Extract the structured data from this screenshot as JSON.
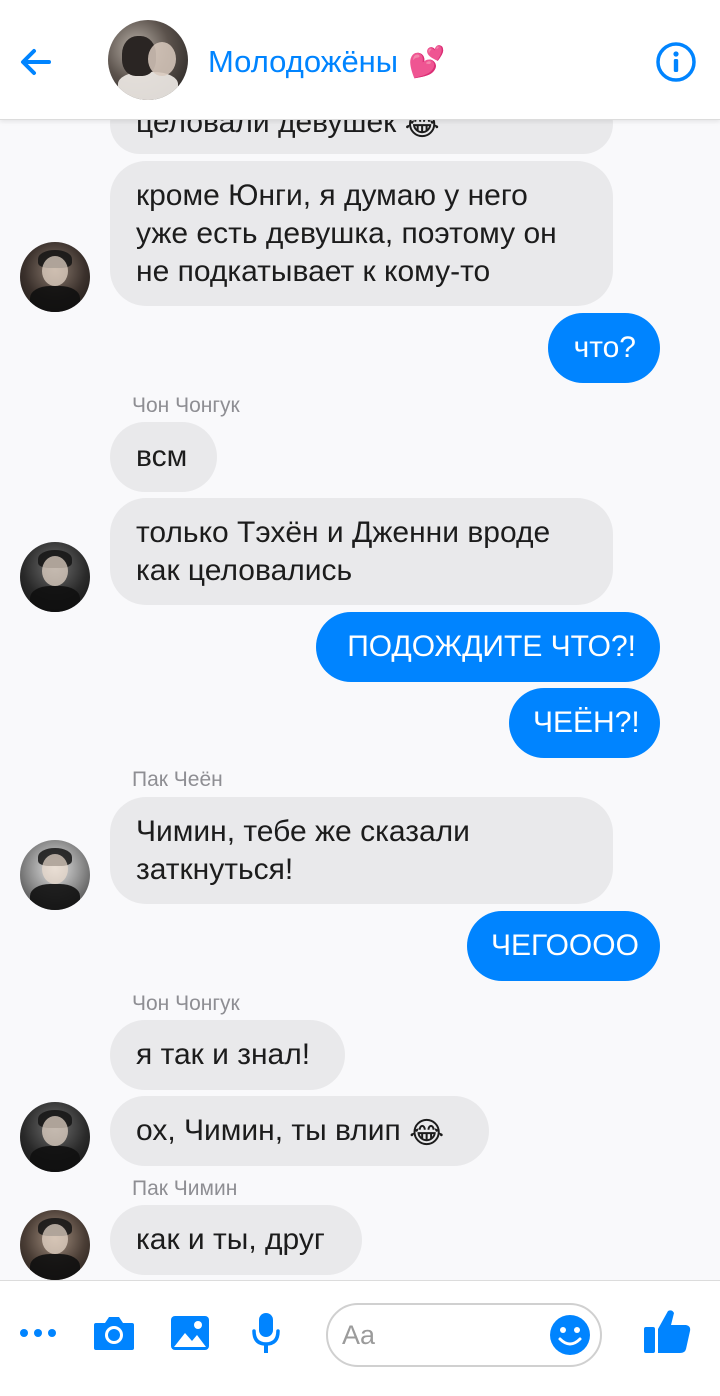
{
  "header": {
    "title": "Молодожёны",
    "title_emoji": "💕"
  },
  "messages": {
    "m1": "целовали девушек",
    "m2": "кроме Юнги, я думаю у него уже есть девушка, поэтому он не подкатывает к кому-то",
    "m3": "что?",
    "s1": "Чон Чонгук",
    "m4": "всм",
    "m5": "только Тэхён и Дженни вроде как целовались",
    "m6": "ПОДОЖДИТЕ ЧТО?!",
    "m7": "ЧЕЁН?!",
    "s2": "Пак Чеён",
    "m8": "Чимин, тебе же сказали заткнуться!",
    "m9": "ЧЕГОООО",
    "s3": "Чон Чонгук",
    "m10": "я так и знал!",
    "m11": "ох, Чимин, ты влип",
    "s4": "Пак Чимин",
    "m12": "как и ты, друг",
    "laugh_emoji": "😂"
  },
  "composer": {
    "placeholder": "Aa"
  },
  "colors": {
    "accent": "#0084ff",
    "incoming_bubble": "#e9e9eb"
  }
}
